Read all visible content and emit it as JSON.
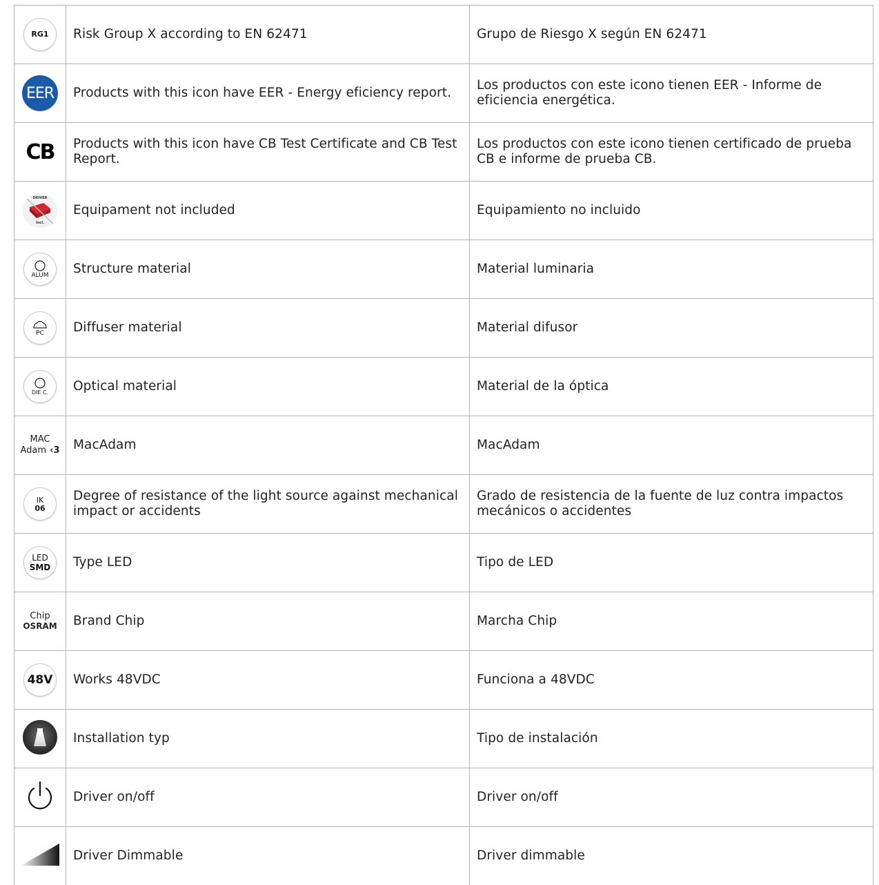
{
  "rows": [
    {
      "icon": "rg1-badge-icon",
      "icon_text": "RG1",
      "en": "Risk Group X according to EN 62471",
      "es": "Grupo de Riesgo X según EN 62471"
    },
    {
      "icon": "eer-badge-icon",
      "icon_text": "EER",
      "en": "Products with this icon have EER - Energy eficiency report.",
      "es": "Los productos con este icono tienen EER - Informe de eficiencia energética."
    },
    {
      "icon": "cb-mark-icon",
      "icon_text": "CB",
      "en": "Products with this icon have CB Test Certificate and CB Test Report.",
      "es": "Los productos con este icono tienen certificado de prueba CB e informe de prueba CB."
    },
    {
      "icon": "driver-not-included-icon",
      "icon_text_top": "DRIVER",
      "icon_text_bottom": "Incl.",
      "en": "Equipament not included",
      "es": "Equipamiento no incluido"
    },
    {
      "icon": "structure-material-icon",
      "icon_text": "ALUM",
      "en": "Structure material",
      "es": "Material luminaria"
    },
    {
      "icon": "diffuser-material-icon",
      "icon_text": "PC",
      "en": "Diffuser material",
      "es": "Material difusor"
    },
    {
      "icon": "optical-material-icon",
      "icon_text": "DIE C.",
      "en": "Optical material",
      "es": "Material de la óptica"
    },
    {
      "icon": "macadam-icon",
      "icon_text_top": "MAC",
      "icon_text_bottom": "Adam",
      "icon_text_bold": "‹3",
      "en": "MacAdam",
      "es": "MacAdam"
    },
    {
      "icon": "ik-rating-icon",
      "icon_text_top": "IK",
      "icon_text_bottom": "06",
      "en": "Degree of resistance of the light source against mechanical impact or accidents",
      "es": "Grado de resistencia de la fuente de luz contra impactos mecánicos o accidentes"
    },
    {
      "icon": "led-type-icon",
      "icon_text_top": "LED",
      "icon_text_bottom": "SMD",
      "en": "Type LED",
      "es": "Tipo de LED"
    },
    {
      "icon": "chip-brand-icon",
      "icon_text_top": "Chip",
      "icon_text_bottom": "OSRAM",
      "en": "Brand Chip",
      "es": "Marcha Chip"
    },
    {
      "icon": "voltage-48v-icon",
      "icon_text": "48V",
      "en": "Works 48VDC",
      "es": "Funciona a 48VDC"
    },
    {
      "icon": "installation-type-icon",
      "en": "Installation typ",
      "es": "Tipo de instalación"
    },
    {
      "icon": "power-icon",
      "en": "Driver on/off",
      "es": "Driver on/off"
    },
    {
      "icon": "dimmable-ramp-icon",
      "en": "Driver Dimmable",
      "es": "Driver dimmable"
    }
  ],
  "colors": {
    "eer_blue": "#1a5aa8",
    "border": "#b5b5b5",
    "driver_red": "#c0202a"
  }
}
